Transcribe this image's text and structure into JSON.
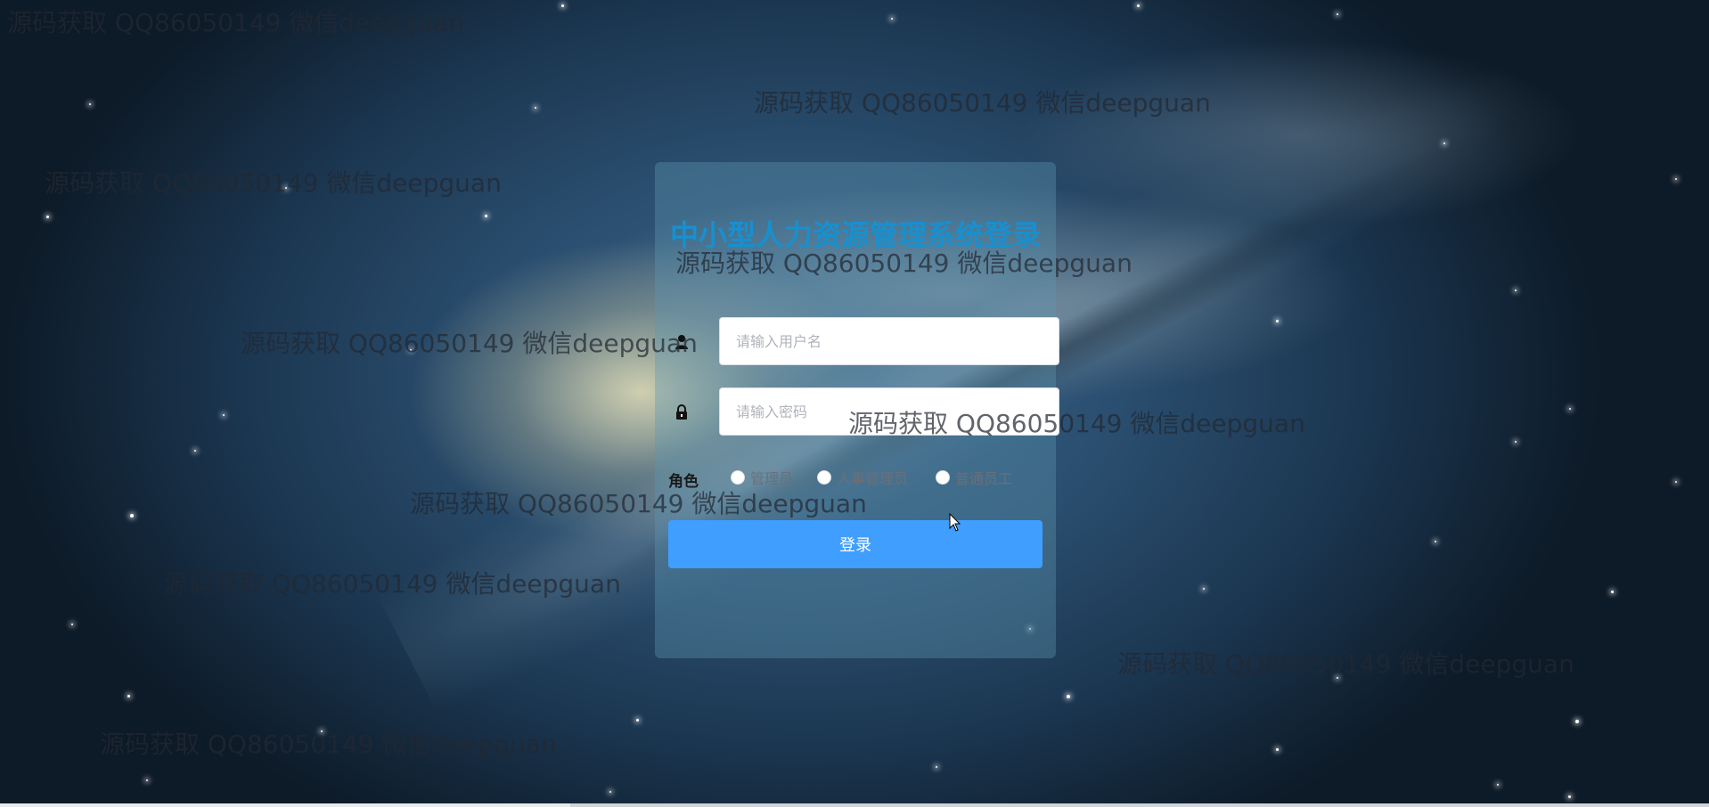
{
  "login": {
    "title": "中小型人力资源管理系统登录",
    "username_placeholder": "请输入用户名",
    "password_placeholder": "请输入密码",
    "role_label": "角色",
    "roles": [
      "管理员",
      "人事管理员",
      "普通员工"
    ],
    "submit_label": "登录"
  },
  "watermark_text": "源码获取 QQ86050149 微信deepguan",
  "icons": {
    "username": "user-icon",
    "password": "lock-icon"
  },
  "colors": {
    "title": "#1790d0",
    "button": "#409eff",
    "panel": "rgba(95,150,175,0.38)"
  }
}
